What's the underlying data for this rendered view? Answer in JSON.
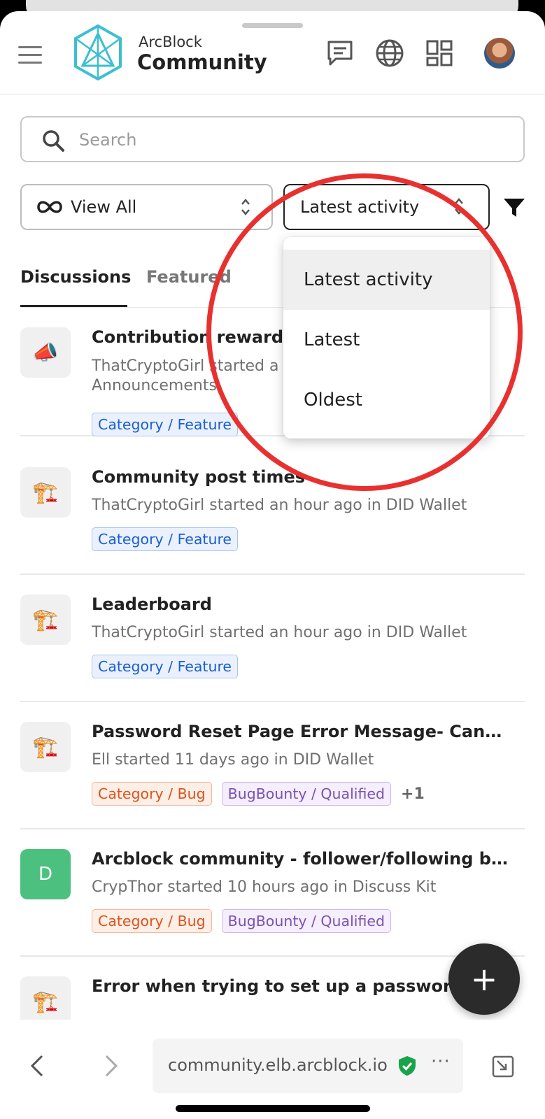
{
  "header": {
    "brand_top": "ArcBlock",
    "brand_main": "Community",
    "accent_color": "#3bbfd1"
  },
  "search": {
    "placeholder": "Search"
  },
  "filters": {
    "view_label": "View All",
    "sort_label": "Latest activity"
  },
  "tabs": {
    "discussions": "Discussions",
    "featured": "Featured"
  },
  "sort_menu": {
    "options": [
      "Latest activity",
      "Latest",
      "Oldest"
    ],
    "selected": "Latest activity"
  },
  "posts": [
    {
      "icon": "megaphone-icon",
      "title": "Contribution rewards",
      "subtitle": "ThatCryptoGirl started a",
      "subtitle2": "Announcements",
      "tags": [
        "Category / Feature"
      ]
    },
    {
      "icon": "crane-icon",
      "title": "Community post times",
      "subtitle": "ThatCryptoGirl started an hour ago in DID Wallet",
      "tags": [
        "Category / Feature"
      ]
    },
    {
      "icon": "crane-icon",
      "title": "Leaderboard",
      "subtitle": "ThatCryptoGirl started an hour ago in DID Wallet",
      "tags": [
        "Category / Feature"
      ]
    },
    {
      "icon": "crane-icon",
      "title": "Password Reset Page Error Message- Cannot…",
      "subtitle": "Ell started 11 days ago in DID Wallet",
      "tags": [
        "Category / Bug",
        "BugBounty / Qualified"
      ],
      "more": "+1"
    },
    {
      "avatar_letter": "D",
      "title": "Arcblock community - follower/following bug",
      "subtitle": "CrypThor started 10 hours ago in Discuss Kit",
      "tags": [
        "Category / Bug",
        "BugBounty / Qualified"
      ]
    },
    {
      "icon": "crane-icon",
      "title": "Error when trying to set up a password for DI…"
    }
  ],
  "fab_label": "+",
  "browser": {
    "url": "community.elb.arcblock.io",
    "menu": "···"
  },
  "colors": {
    "highlight_ring": "#e8312f",
    "tag_blue": "#1a5fd0",
    "tag_orange": "#d9541e",
    "tag_purple": "#7b52b0"
  }
}
